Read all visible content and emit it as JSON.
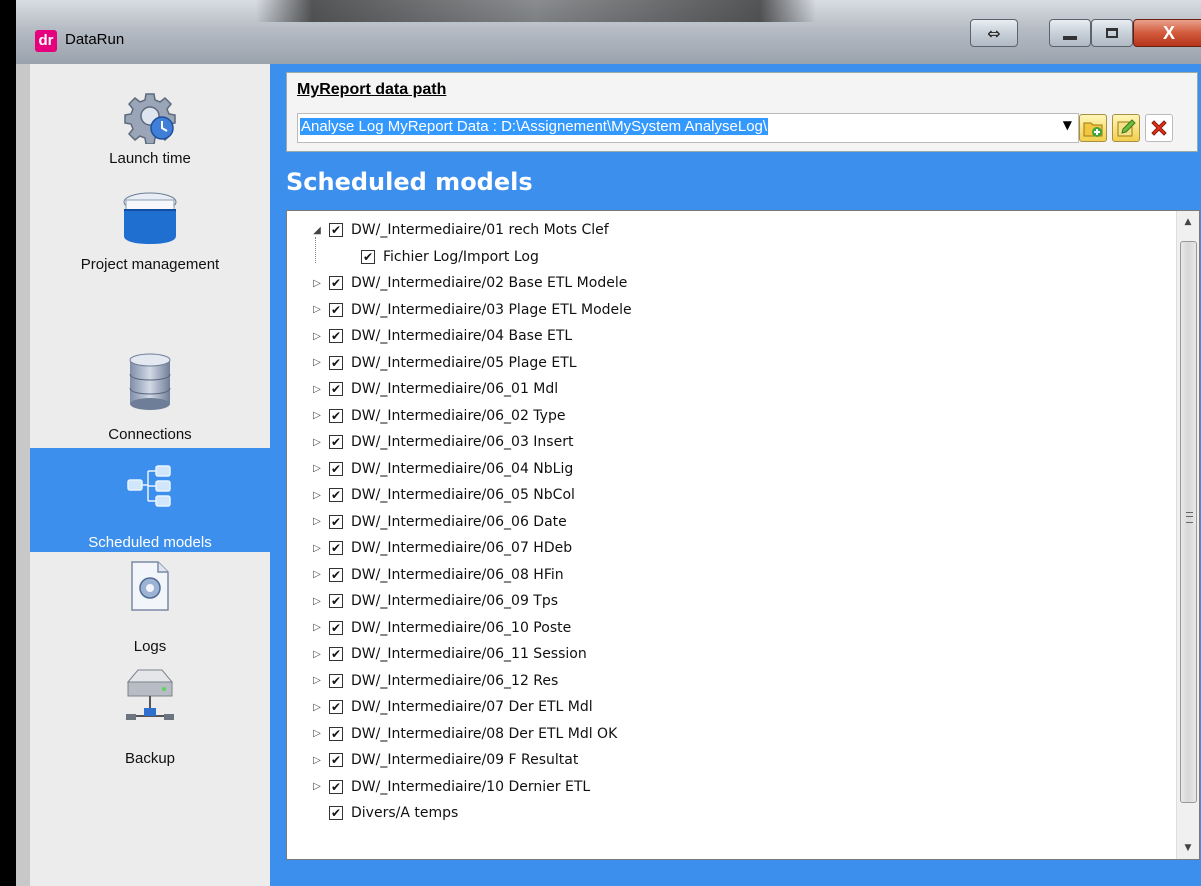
{
  "window": {
    "app_logo": "dr",
    "title": "DataRun",
    "buttons": {
      "resize": "⇔",
      "close": "X"
    }
  },
  "sidebar": {
    "items": [
      {
        "label": "Launch time",
        "icon": "gear-clock-icon",
        "selected": false
      },
      {
        "label": "Project management",
        "icon": "blue-folder-icon",
        "selected": false
      },
      {
        "label": "Connections",
        "icon": "database-icon",
        "selected": false
      },
      {
        "label": "Scheduled models",
        "icon": "model-tree-icon",
        "selected": true
      },
      {
        "label": "Logs",
        "icon": "log-file-gear-icon",
        "selected": false
      },
      {
        "label": "Backup",
        "icon": "network-drive-icon",
        "selected": false
      }
    ]
  },
  "path": {
    "label": "MyReport data path",
    "value": "Analyse Log MyReport Data : D:\\Assignement\\MySystem AnalyseLog\\"
  },
  "section": {
    "title": "Scheduled models"
  },
  "tree": {
    "rows": [
      {
        "label": "DW/_Intermediaire/01 rech Mots Clef",
        "expander": "◢",
        "checked": "✔"
      },
      {
        "label": "Fichier Log/Import Log",
        "expander": "",
        "checked": "✔"
      },
      {
        "label": "DW/_Intermediaire/02 Base ETL Modele",
        "expander": "▷",
        "checked": "✔"
      },
      {
        "label": "DW/_Intermediaire/03 Plage ETL Modele",
        "expander": "▷",
        "checked": "✔"
      },
      {
        "label": "DW/_Intermediaire/04 Base ETL",
        "expander": "▷",
        "checked": "✔"
      },
      {
        "label": "DW/_Intermediaire/05 Plage ETL",
        "expander": "▷",
        "checked": "✔"
      },
      {
        "label": "DW/_Intermediaire/06_01 Mdl",
        "expander": "▷",
        "checked": "✔"
      },
      {
        "label": "DW/_Intermediaire/06_02 Type",
        "expander": "▷",
        "checked": "✔"
      },
      {
        "label": "DW/_Intermediaire/06_03 Insert",
        "expander": "▷",
        "checked": "✔"
      },
      {
        "label": "DW/_Intermediaire/06_04 NbLig",
        "expander": "▷",
        "checked": "✔"
      },
      {
        "label": "DW/_Intermediaire/06_05 NbCol",
        "expander": "▷",
        "checked": "✔"
      },
      {
        "label": "DW/_Intermediaire/06_06 Date",
        "expander": "▷",
        "checked": "✔"
      },
      {
        "label": "DW/_Intermediaire/06_07 HDeb",
        "expander": "▷",
        "checked": "✔"
      },
      {
        "label": "DW/_Intermediaire/06_08 HFin",
        "expander": "▷",
        "checked": "✔"
      },
      {
        "label": "DW/_Intermediaire/06_09 Tps",
        "expander": "▷",
        "checked": "✔"
      },
      {
        "label": "DW/_Intermediaire/06_10 Poste",
        "expander": "▷",
        "checked": "✔"
      },
      {
        "label": "DW/_Intermediaire/06_11 Session",
        "expander": "▷",
        "checked": "✔"
      },
      {
        "label": "DW/_Intermediaire/06_12 Res",
        "expander": "▷",
        "checked": "✔"
      },
      {
        "label": "DW/_Intermediaire/07 Der ETL Mdl",
        "expander": "▷",
        "checked": "✔"
      },
      {
        "label": "DW/_Intermediaire/08 Der ETL Mdl OK",
        "expander": "▷",
        "checked": "✔"
      },
      {
        "label": "DW/_Intermediaire/09 F Resultat",
        "expander": "▷",
        "checked": "✔"
      },
      {
        "label": "DW/_Intermediaire/10 Dernier ETL",
        "expander": "▷",
        "checked": "✔"
      },
      {
        "label": "Divers/A temps",
        "expander": "",
        "checked": "✔"
      }
    ]
  },
  "scrollbar": {
    "up": "▲",
    "down": "▼"
  },
  "colors": {
    "accent_blue": "#3d8fee",
    "selection_blue": "#3399ff",
    "close_red": "#d25a3b"
  }
}
